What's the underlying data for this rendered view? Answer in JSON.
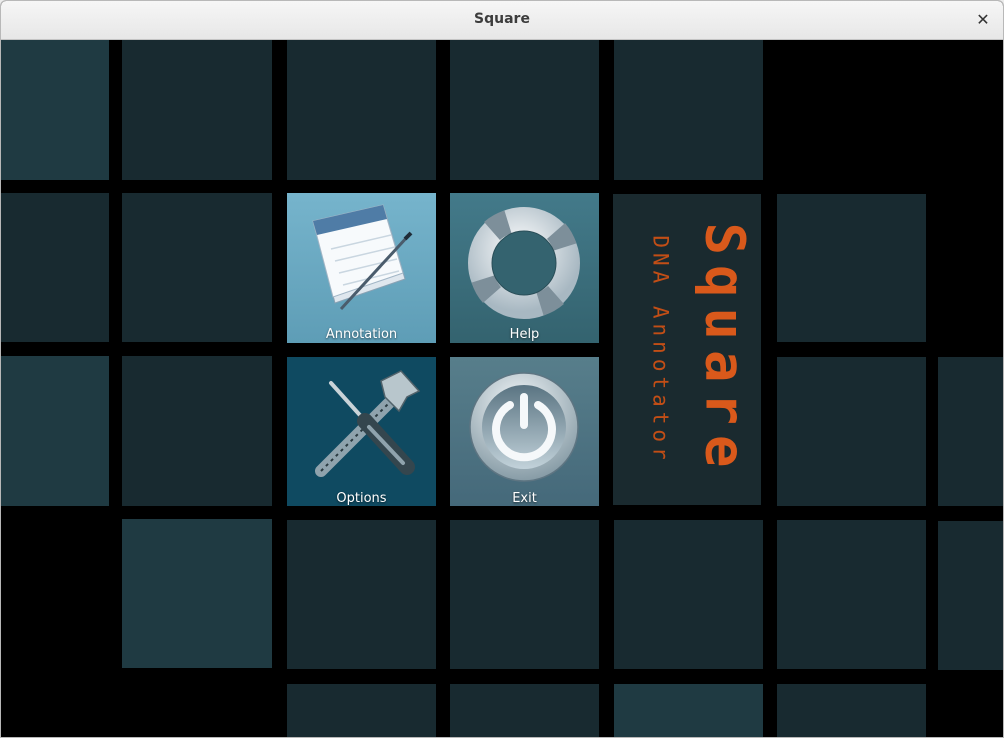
{
  "window": {
    "title": "Square",
    "close_glyph": "✕"
  },
  "menu": {
    "annotation": {
      "label": "Annotation",
      "icon": "notepad-pen-icon"
    },
    "help": {
      "label": "Help",
      "icon": "lifebuoy-icon"
    },
    "options": {
      "label": "Options",
      "icon": "tools-icon"
    },
    "exit": {
      "label": "Exit",
      "icon": "power-icon"
    }
  },
  "logo": {
    "title": "Square",
    "subtitle": "DNA Annotator"
  },
  "colors": {
    "tile": "#182a30",
    "tile_light": "#1f3a42",
    "accent": "#d9591b",
    "annotation_bg": "#6aa9c2",
    "help_bg": "#3c6d7c",
    "options_bg": "#0f4a61",
    "exit_bg": "#4f7683"
  }
}
